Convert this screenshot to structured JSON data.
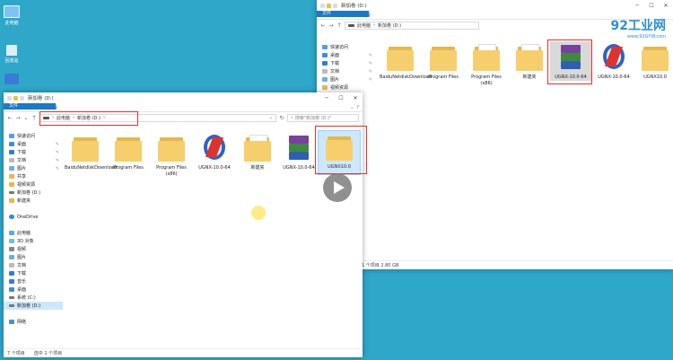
{
  "desktop": {
    "icons": [
      {
        "label": "此电脑",
        "icon": "computer-icon"
      },
      {
        "label": "回收站",
        "icon": "recycle-bin-icon"
      },
      {
        "label": "控制面板",
        "icon": "control-panel-icon"
      }
    ]
  },
  "watermark": {
    "brand": "92工业网",
    "url": "www.92GYW.com"
  },
  "back_window": {
    "title": "新加卷 (D:)",
    "ribbon": {
      "file": "文件",
      "tabs": [
        "主页",
        "共享",
        "查看"
      ]
    },
    "address": {
      "parts": [
        "此电脑",
        "新加卷 (D:)"
      ]
    },
    "sidebar": [
      {
        "label": "快速访问"
      },
      {
        "label": "桌面"
      },
      {
        "label": "下载"
      },
      {
        "label": "文档"
      },
      {
        "label": "图片"
      },
      {
        "label": "视频资源"
      }
    ],
    "files": [
      {
        "label": "BaiduNetdiskDownload",
        "kind": "folder"
      },
      {
        "label": "Program Files",
        "kind": "folder"
      },
      {
        "label": "Program Files (x86)",
        "kind": "folder-doc"
      },
      {
        "label": "新建夹",
        "kind": "folder-doc"
      },
      {
        "label": "UGNX-10.0-64",
        "kind": "rar"
      },
      {
        "label": "UGNX-10.0-64",
        "kind": "iso"
      },
      {
        "label": "UGNX10.0",
        "kind": "folder"
      }
    ],
    "status": "1 个项目 2.80 GB"
  },
  "front_window": {
    "title": "新加卷 (D:)",
    "ribbon": {
      "file": "文件",
      "tabs": [
        "主页",
        "共享",
        "查看"
      ]
    },
    "address": {
      "parts": [
        "此电脑",
        "新加卷 (D:)"
      ]
    },
    "search_placeholder": "搜索\"新加卷 (D:)\"",
    "sidebar": [
      {
        "label": "快速访问",
        "icon": "star-icon",
        "pin": false
      },
      {
        "label": "桌面",
        "icon": "desktop-icon",
        "pin": true
      },
      {
        "label": "下载",
        "icon": "download-icon",
        "pin": true
      },
      {
        "label": "文档",
        "icon": "document-icon",
        "pin": true
      },
      {
        "label": "图片",
        "icon": "picture-icon",
        "pin": true
      },
      {
        "label": "共享",
        "icon": "folder-icon",
        "pin": false
      },
      {
        "label": "视频资源",
        "icon": "folder-icon",
        "pin": false
      },
      {
        "label": "新加卷 (D:)",
        "icon": "drive-icon",
        "pin": false
      },
      {
        "label": "新建夹",
        "icon": "folder-icon",
        "pin": false
      },
      {
        "label": "",
        "icon": "",
        "pin": false
      },
      {
        "label": "OneDrive",
        "icon": "cloud-icon",
        "pin": false
      },
      {
        "label": "",
        "icon": "",
        "pin": false
      },
      {
        "label": "此电脑",
        "icon": "computer-icon",
        "pin": false
      },
      {
        "label": "3D 对象",
        "icon": "cube-icon",
        "pin": false
      },
      {
        "label": "视频",
        "icon": "video-icon",
        "pin": false
      },
      {
        "label": "图片",
        "icon": "picture-icon",
        "pin": false
      },
      {
        "label": "文档",
        "icon": "document-icon",
        "pin": false
      },
      {
        "label": "下载",
        "icon": "download-icon",
        "pin": false
      },
      {
        "label": "音乐",
        "icon": "music-icon",
        "pin": false
      },
      {
        "label": "桌面",
        "icon": "desktop-icon",
        "pin": false
      },
      {
        "label": "系统 (C:)",
        "icon": "drive-icon",
        "pin": false
      },
      {
        "label": "新加卷 (D:)",
        "icon": "drive-icon",
        "pin": false
      },
      {
        "label": "",
        "icon": "",
        "pin": false
      },
      {
        "label": "网络",
        "icon": "network-icon",
        "pin": false
      }
    ],
    "files": [
      {
        "label": "BaiduNetdiskDownload",
        "kind": "folder"
      },
      {
        "label": "Program Files",
        "kind": "folder"
      },
      {
        "label": "Program Files (x86)",
        "kind": "folder"
      },
      {
        "label": "UGNX-10.0-64",
        "kind": "iso"
      },
      {
        "label": "新建夹",
        "kind": "folder-doc"
      },
      {
        "label": "UGNX-10.0-64",
        "kind": "rar"
      },
      {
        "label": "UGNX10.0",
        "kind": "folder"
      }
    ],
    "status": {
      "count": "7 个项目",
      "selected": "选中 1 个项目"
    }
  },
  "colors": {
    "desktop": "#2ea7c9",
    "accent": "#1979ca",
    "highlight": "#e0322d",
    "selection": "#cce8ff"
  }
}
